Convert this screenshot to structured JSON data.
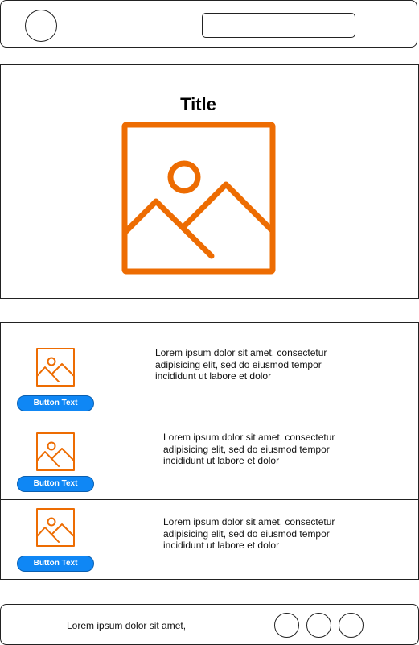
{
  "header": {
    "avatar_icon": "avatar-circle-icon",
    "search": {
      "value": "",
      "placeholder": ""
    }
  },
  "hero": {
    "title": "Title",
    "image_icon": "image-placeholder-icon"
  },
  "list": {
    "items": [
      {
        "thumbnail_icon": "image-placeholder-icon",
        "button_label": "Button Text",
        "text": "Lorem ipsum dolor sit amet, consectetur adipisicing elit, sed do eiusmod tempor incididunt ut labore et dolor"
      },
      {
        "thumbnail_icon": "image-placeholder-icon",
        "button_label": "Button Text",
        "text": "Lorem ipsum dolor sit amet, consectetur adipisicing elit, sed do eiusmod tempor incididunt ut labore et dolor"
      },
      {
        "thumbnail_icon": "image-placeholder-icon",
        "button_label": "Button Text",
        "text": "Lorem ipsum dolor sit amet, consectetur adipisicing elit, sed do eiusmod tempor incididunt ut labore et dolor"
      }
    ]
  },
  "footer": {
    "text": "Lorem ipsum dolor sit amet,",
    "circle_icons": [
      "circle-icon",
      "circle-icon",
      "circle-icon"
    ]
  },
  "colors": {
    "accent_orange": "#ed6c02",
    "button_blue": "#0f87f5",
    "border": "#222222"
  }
}
